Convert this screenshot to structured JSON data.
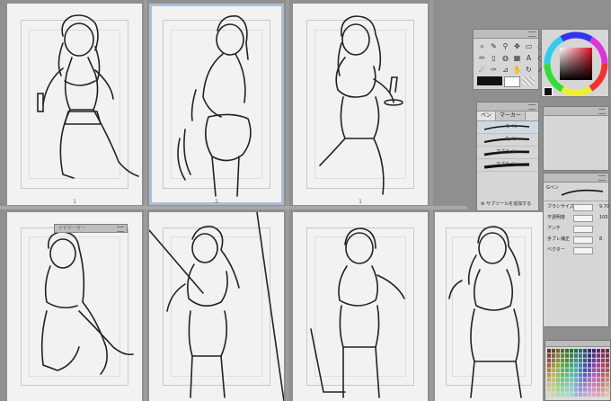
{
  "pages": [
    {
      "number": "1"
    },
    {
      "number": "2"
    },
    {
      "number": "1"
    }
  ],
  "tool_panel": {
    "tools": [
      "zoom-icon",
      "pen-icon",
      "eyedropper-icon",
      "move-icon",
      "select-icon",
      "lasso-icon",
      "brush-icon",
      "eraser-icon",
      "fill-icon",
      "gradient-icon",
      "text-icon",
      "shape-icon",
      "blend-icon",
      "marker-icon",
      "ruler-icon",
      "hand-icon",
      "rotate-icon",
      "arrow-icon"
    ],
    "glyphs": [
      "⌕",
      "✎",
      "⚲",
      "✥",
      "▭",
      "◌",
      "✏",
      "▯",
      "◍",
      "▦",
      "A",
      "◇",
      "☄",
      "✑",
      "⊿",
      "✋",
      "↻",
      "➚"
    ],
    "main_color": "#111111",
    "sub_color": "#ffffff"
  },
  "color_wheel": {
    "hue_color": "#d8102a"
  },
  "brush_panel": {
    "tabs": [
      "ペン",
      "マーカー"
    ],
    "active_tab": "ペン",
    "brushes": [
      "Gペン",
      "丸ペン",
      "カブラペン",
      "カブラペン"
    ],
    "selected_brush": "Gペン",
    "footer": "サブツールを追加する"
  },
  "tool_property": {
    "brush_name": "Gペン",
    "rows": [
      {
        "label": "ブラシサイズ",
        "value": "9.70"
      },
      {
        "label": "不透明度",
        "value": "100"
      },
      {
        "label": "アンチ",
        "value": ""
      },
      {
        "label": "手ブレ補正",
        "value": "8"
      },
      {
        "label": "ベクター",
        "value": ""
      }
    ]
  },
  "floating_window": {
    "title": "ナビゲーター"
  }
}
